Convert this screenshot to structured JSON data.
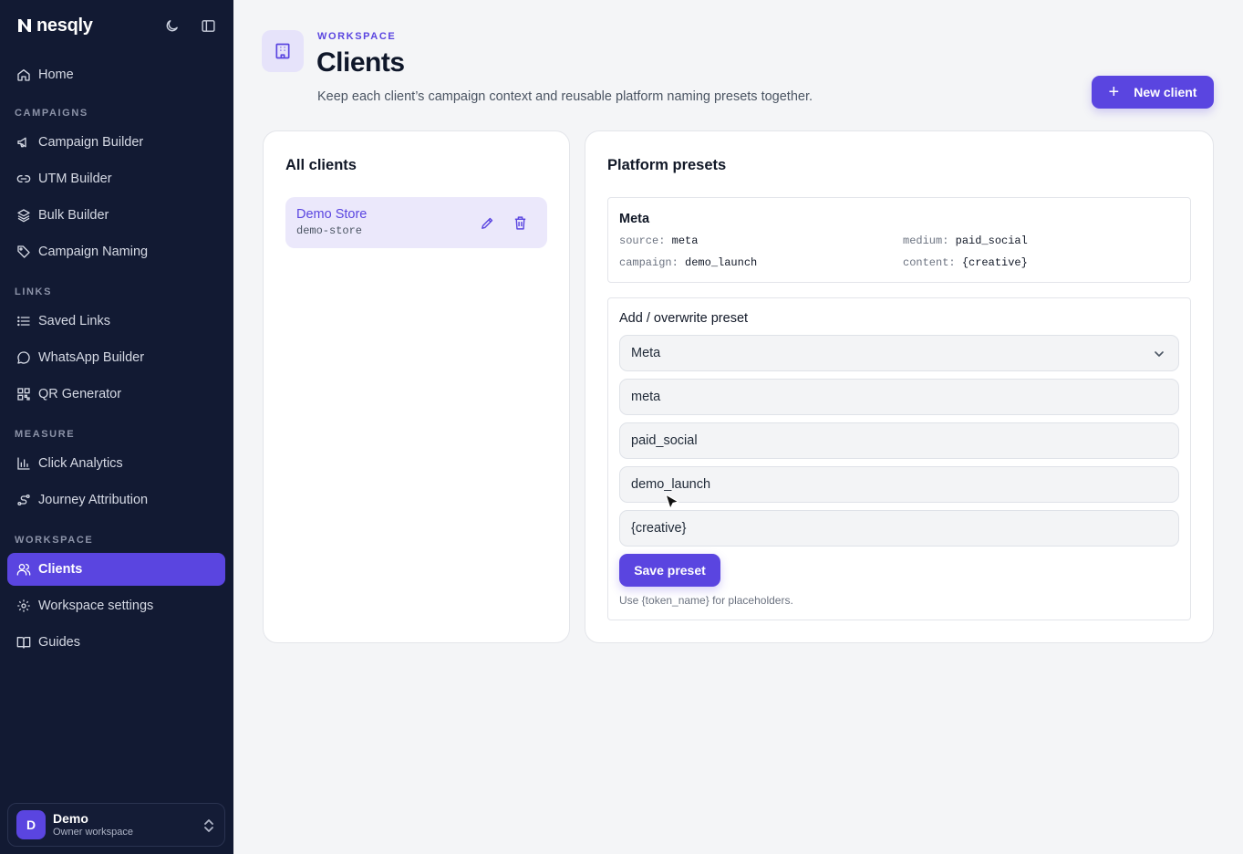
{
  "app": {
    "name": "nesqly"
  },
  "sidebar": {
    "home": {
      "label": "Home",
      "icon": "home-icon"
    },
    "sections": {
      "campaigns": "CAMPAIGNS",
      "links": "LINKS",
      "measure": "MEASURE",
      "workspace": "WORKSPACE"
    },
    "items": [
      {
        "label": "Campaign Builder",
        "icon": "megaphone-icon"
      },
      {
        "label": "UTM Builder",
        "icon": "link-icon"
      },
      {
        "label": "Bulk Builder",
        "icon": "layers-icon"
      },
      {
        "label": "Campaign Naming",
        "icon": "tag-icon"
      },
      {
        "label": "Saved Links",
        "icon": "list-icon"
      },
      {
        "label": "WhatsApp Builder",
        "icon": "chat-bubble-icon"
      },
      {
        "label": "QR Generator",
        "icon": "qr-code-icon"
      },
      {
        "label": "Click Analytics",
        "icon": "bar-chart-icon"
      },
      {
        "label": "Journey Attribution",
        "icon": "journey-icon"
      },
      {
        "label": "Clients",
        "icon": "users-icon",
        "active": true
      },
      {
        "label": "Workspace settings",
        "icon": "gear-icon"
      },
      {
        "label": "Guides",
        "icon": "book-icon"
      }
    ],
    "workspace": {
      "avatar": "D",
      "name": "Demo",
      "role": "Owner workspace"
    }
  },
  "header": {
    "eyebrow": "WORKSPACE",
    "title": "Clients",
    "subtitle": "Keep each client’s campaign context and reusable platform naming presets together.",
    "new_button": "New client"
  },
  "clients_panel": {
    "title": "All clients",
    "clients": [
      {
        "name": "Demo Store",
        "slug": "demo-store"
      }
    ]
  },
  "presets_panel": {
    "title": "Platform presets",
    "preset": {
      "name": "Meta",
      "source_key": "source:",
      "source_val": "meta",
      "medium_key": "medium:",
      "medium_val": "paid_social",
      "campaign_key": "campaign:",
      "campaign_val": "demo_launch",
      "content_key": "content:",
      "content_val": "{creative}"
    },
    "form": {
      "title": "Add / overwrite preset",
      "platform": "Meta",
      "source": "meta",
      "medium": "paid_social",
      "campaign": "demo_launch",
      "content": "{creative}",
      "save_button": "Save preset",
      "hint": "Use {token_name} for placeholders."
    }
  },
  "colors": {
    "accent": "#5a45e0",
    "sidebar_bg": "#121a33",
    "page_bg": "#f4f5f7"
  }
}
